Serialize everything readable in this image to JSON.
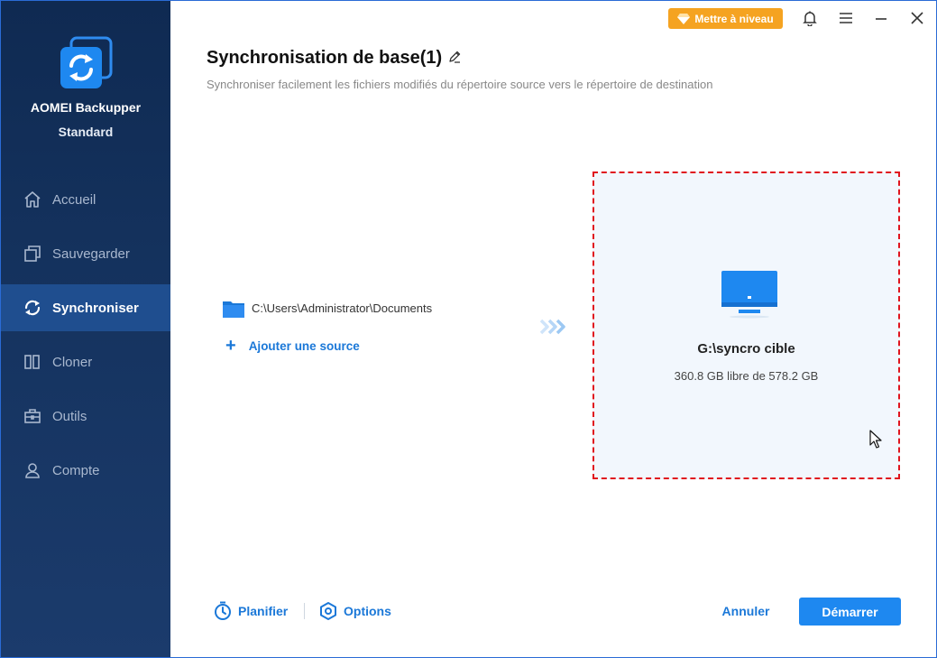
{
  "sidebar": {
    "brand_name": "AOMEI Backupper",
    "brand_edition": "Standard",
    "items": [
      {
        "label": "Accueil",
        "icon": "home-icon"
      },
      {
        "label": "Sauvegarder",
        "icon": "backup-icon"
      },
      {
        "label": "Synchroniser",
        "icon": "sync-icon",
        "active": true
      },
      {
        "label": "Cloner",
        "icon": "clone-icon"
      },
      {
        "label": "Outils",
        "icon": "tools-icon"
      },
      {
        "label": "Compte",
        "icon": "account-icon"
      }
    ]
  },
  "topbar": {
    "upgrade_label": "Mettre à niveau"
  },
  "header": {
    "title": "Synchronisation de base(1)",
    "subtitle": "Synchroniser facilement les fichiers modifiés du répertoire source vers le répertoire de destination"
  },
  "source": {
    "path": "C:\\Users\\Administrator\\Documents",
    "add_label": "Ajouter une source"
  },
  "destination": {
    "name": "G:\\syncro cible",
    "space": "360.8 GB libre de 578.2 GB"
  },
  "footer": {
    "schedule_label": "Planifier",
    "options_label": "Options",
    "cancel_label": "Annuler",
    "start_label": "Démarrer"
  },
  "colors": {
    "accent": "#1e88f0",
    "upgrade": "#f5a321",
    "dest_border": "#e0141e",
    "sidebar_bg": "#15335f"
  }
}
